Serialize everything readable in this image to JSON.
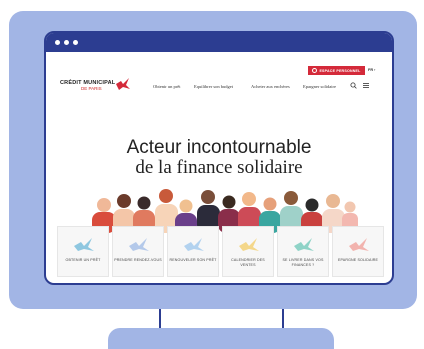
{
  "site": {
    "logo_main": "CRÉDIT MUNICIPAL",
    "logo_sub": "DE PARIS",
    "espace_button": "ESPACE PERSONNEL",
    "language": "FR"
  },
  "nav": [
    {
      "label": "Obtenir un prêt"
    },
    {
      "label": "Equilibrer son budget"
    },
    {
      "label": "Acheter aux enchères"
    },
    {
      "label": "Epargner solidaire"
    }
  ],
  "hero": {
    "line1": "Acteur incontournable",
    "line2": "de la finance solidaire"
  },
  "tiles": [
    {
      "label": "OBTENIR UN PRÊT",
      "icon": "bird-icon",
      "color": "#8ec7e0"
    },
    {
      "label": "PRENDRE RENDEZ-VOUS",
      "icon": "bird-icon",
      "color": "#b4c9ea"
    },
    {
      "label": "RENOUVELER SON PRÊT",
      "icon": "bird-icon",
      "color": "#b2d2ef"
    },
    {
      "label": "CALENDRIER DES VENTES",
      "icon": "bird-icon",
      "color": "#f4d78a"
    },
    {
      "label": "SE LIVRER DANS VOS FINANCES ?",
      "icon": "bird-icon",
      "color": "#8fd3c7"
    },
    {
      "label": "EPARGNE SOLIDAIRE",
      "icon": "bird-icon",
      "color": "#f2b3ae"
    }
  ],
  "colors": {
    "frame": "#a2b5e5",
    "window_bar": "#2c3d91",
    "brand_red": "#d42a3a"
  }
}
